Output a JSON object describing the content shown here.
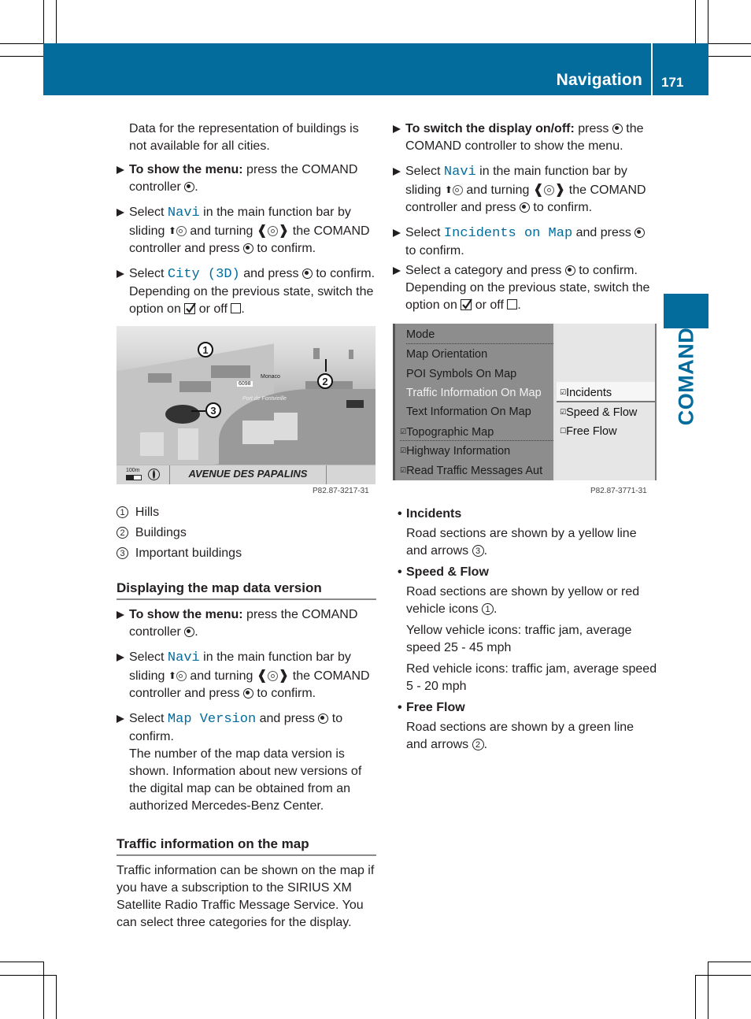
{
  "header": {
    "section": "Navigation",
    "page_number": "171"
  },
  "side_tab": {
    "label": "COMAND"
  },
  "left_column": {
    "intro": "Data for the representation of buildings is not available for all cities.",
    "steps_city": [
      {
        "bold": "To show the menu:",
        "text": " press the COMAND controller ",
        "end": "."
      },
      {
        "pre": "Select ",
        "mono": "Navi",
        "mid": " in the main function bar by sliding ",
        "mid2": " and turning ",
        "mid3": " the COMAND controller and press ",
        "end": " to confirm."
      },
      {
        "pre": "Select ",
        "mono": "City (3D)",
        "mid": " and press ",
        "mid2": " to confirm. Depending on the previous state, switch the option on ",
        "mid3": " or off ",
        "end": "."
      }
    ],
    "figure1": {
      "callouts": [
        "1",
        "2",
        "3"
      ],
      "street": "AVENUE DES PAPALINS",
      "scale": "100m",
      "labels": [
        "Monaco",
        "6098",
        "Port de Fontvieille"
      ],
      "code": "P82.87-3217-31"
    },
    "legend": [
      {
        "num": "1",
        "label": "Hills"
      },
      {
        "num": "2",
        "label": "Buildings"
      },
      {
        "num": "3",
        "label": "Important buildings"
      }
    ],
    "section2": {
      "title": "Displaying the map data version",
      "steps": [
        {
          "bold": "To show the menu:",
          "text": " press the COMAND controller ",
          "end": "."
        },
        {
          "pre": "Select ",
          "mono": "Navi",
          "mid": " in the main function bar by sliding ",
          "mid2": " and turning ",
          "mid3": " the COMAND controller and press ",
          "end": " to confirm."
        },
        {
          "pre": "Select ",
          "mono": "Map Version",
          "mid": " and press ",
          "end": " to confirm.",
          "note": "The number of the map data version is shown. Information about new versions of the digital map can be obtained from an authorized Mercedes-Benz Center."
        }
      ]
    },
    "section3": {
      "title": "Traffic information on the map",
      "body": "Traffic information can be shown on the map if you have a subscription to the SIRIUS XM Satellite Radio Traffic Message Service. You can select three categories for the display."
    }
  },
  "right_column": {
    "steps": [
      {
        "bold": "To switch the display on/off:",
        "text": " press ",
        "end": " the COMAND controller to show the menu."
      },
      {
        "pre": "Select ",
        "mono": "Navi",
        "mid": " in the main function bar by sliding ",
        "mid2": " and turning ",
        "mid3": " the COMAND controller and press ",
        "end": " to confirm."
      },
      {
        "pre": "Select ",
        "mono": "Incidents on Map",
        "mid": " and press ",
        "end": " to confirm."
      },
      {
        "pre": "Select a category and press ",
        "mid": " to confirm. Depending on the previous state, switch the option on ",
        "mid2": " or off ",
        "end": "."
      }
    ],
    "figure2": {
      "menu_items": [
        {
          "label": "Mode",
          "checked": null,
          "selected": false
        },
        {
          "label": "Map Orientation",
          "checked": null,
          "selected": false
        },
        {
          "label": "POI Symbols On Map",
          "checked": null,
          "selected": false
        },
        {
          "label": "Traffic Information On Map",
          "checked": null,
          "selected": true
        },
        {
          "label": "Text Information On Map",
          "checked": null,
          "selected": false
        },
        {
          "label": "Topographic Map",
          "checked": true,
          "selected": false
        },
        {
          "label": "Highway Information",
          "checked": true,
          "selected": false
        },
        {
          "label": "Read Traffic Messages Aut",
          "checked": true,
          "selected": false
        }
      ],
      "submenu_items": [
        {
          "label": "Incidents",
          "checked": true,
          "highlighted": true
        },
        {
          "label": "Speed & Flow",
          "checked": true,
          "highlighted": false
        },
        {
          "label": "Free Flow",
          "checked": false,
          "highlighted": false
        }
      ],
      "code": "P82.87-3771-31"
    },
    "categories": [
      {
        "title": "Incidents",
        "paragraphs": [
          {
            "text": "Road sections are shown by a yellow line and arrows ",
            "ref": "3",
            "end": "."
          }
        ]
      },
      {
        "title": "Speed & Flow",
        "paragraphs": [
          {
            "text": "Road sections are shown by yellow or red vehicle icons ",
            "ref": "1",
            "end": "."
          },
          {
            "text": "Yellow vehicle icons: traffic jam, average speed 25 - 45 mph"
          },
          {
            "text": "Red vehicle icons: traffic jam, average speed 5 - 20 mph"
          }
        ]
      },
      {
        "title": "Free Flow",
        "paragraphs": [
          {
            "text": "Road sections are shown by a green line and arrows ",
            "ref": "2",
            "end": "."
          }
        ]
      }
    ]
  },
  "colors": {
    "brand_blue": "#036c9d",
    "link_mono": "#036c9d",
    "menu_gray": "#8d8d8d"
  }
}
